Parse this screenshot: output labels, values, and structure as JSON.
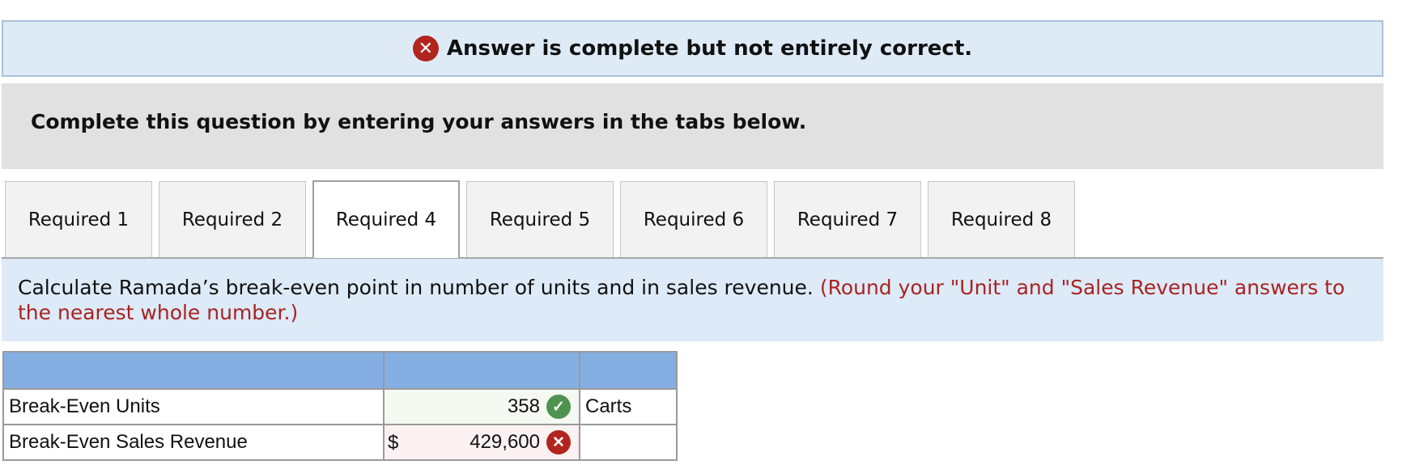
{
  "banner": {
    "icon": "error-circle-icon",
    "text": "Answer is complete but not entirely correct."
  },
  "instruction": {
    "text": "Complete this question by entering your answers in the tabs below."
  },
  "tabs": [
    {
      "label": "Required 1",
      "active": false
    },
    {
      "label": "Required 2",
      "active": false
    },
    {
      "label": "Required 4",
      "active": true
    },
    {
      "label": "Required 5",
      "active": false
    },
    {
      "label": "Required 6",
      "active": false
    },
    {
      "label": "Required 7",
      "active": false
    },
    {
      "label": "Required 8",
      "active": false
    }
  ],
  "question": {
    "text": "Calculate Ramada’s break-even point in number of units and in sales revenue.",
    "note": "(Round your \"Unit\" and \"Sales Revenue\" answers to the nearest whole number.)"
  },
  "answers": {
    "rows": [
      {
        "label": "Break-Even Units",
        "prefix": "",
        "value": "358",
        "status": "correct",
        "unit": "Carts"
      },
      {
        "label": "Break-Even Sales Revenue",
        "prefix": "$",
        "value": "429,600",
        "status": "incorrect",
        "unit": ""
      }
    ]
  },
  "colors": {
    "banner_bg": "#deebf7",
    "error_red": "#b1251e",
    "correct_green": "#4f934f",
    "header_blue": "#85aee2",
    "note_red": "#a82321"
  }
}
